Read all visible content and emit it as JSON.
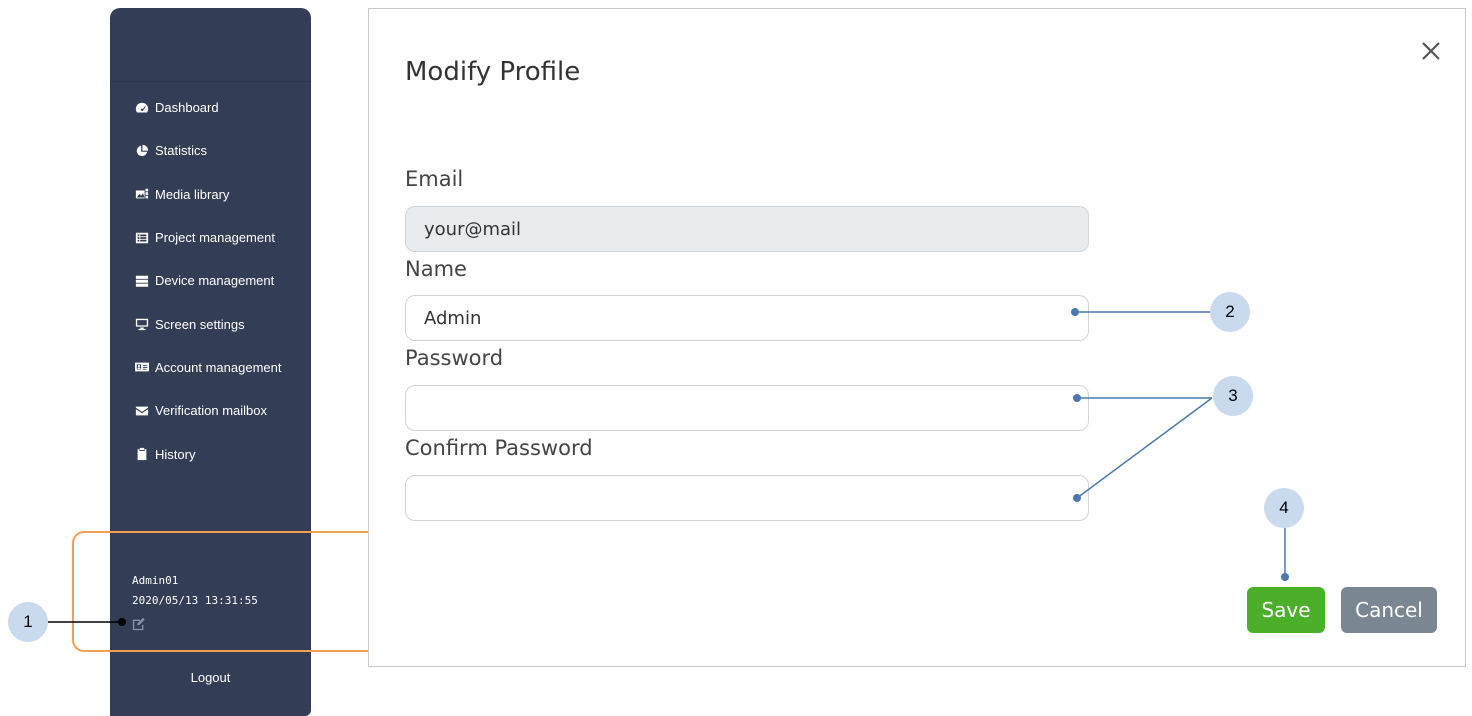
{
  "sidebar": {
    "items": [
      {
        "label": "Dashboard",
        "icon": "dashboard-gauge-icon"
      },
      {
        "label": "Statistics",
        "icon": "pie-chart-icon"
      },
      {
        "label": "Media library",
        "icon": "media-images-icon"
      },
      {
        "label": "Project management",
        "icon": "list-alt-icon"
      },
      {
        "label": "Device management",
        "icon": "server-icon"
      },
      {
        "label": "Screen settings",
        "icon": "monitor-icon"
      },
      {
        "label": "Account management",
        "icon": "id-card-icon"
      },
      {
        "label": "Verification mailbox",
        "icon": "envelope-icon"
      },
      {
        "label": "History",
        "icon": "clipboard-icon"
      }
    ],
    "user": {
      "name": "Admin01",
      "timestamp": "2020/05/13 13:31:55"
    },
    "logout_label": "Logout"
  },
  "modal": {
    "title": "Modify Profile",
    "fields": {
      "email": {
        "label": "Email",
        "value": "your@mail"
      },
      "name": {
        "label": "Name",
        "value": "Admin"
      },
      "password": {
        "label": "Password",
        "value": ""
      },
      "confirm_password": {
        "label": "Confirm Password",
        "value": ""
      }
    },
    "save_label": "Save",
    "cancel_label": "Cancel"
  },
  "callouts": [
    "1",
    "2",
    "3",
    "4"
  ],
  "colors": {
    "sidebar_bg": "#333d55",
    "save_green": "#4caf29",
    "cancel_gray": "#7a8691",
    "highlight_orange": "#f0a050",
    "callout_bg": "#c9d9ee",
    "callout_line": "#4a78b0"
  }
}
